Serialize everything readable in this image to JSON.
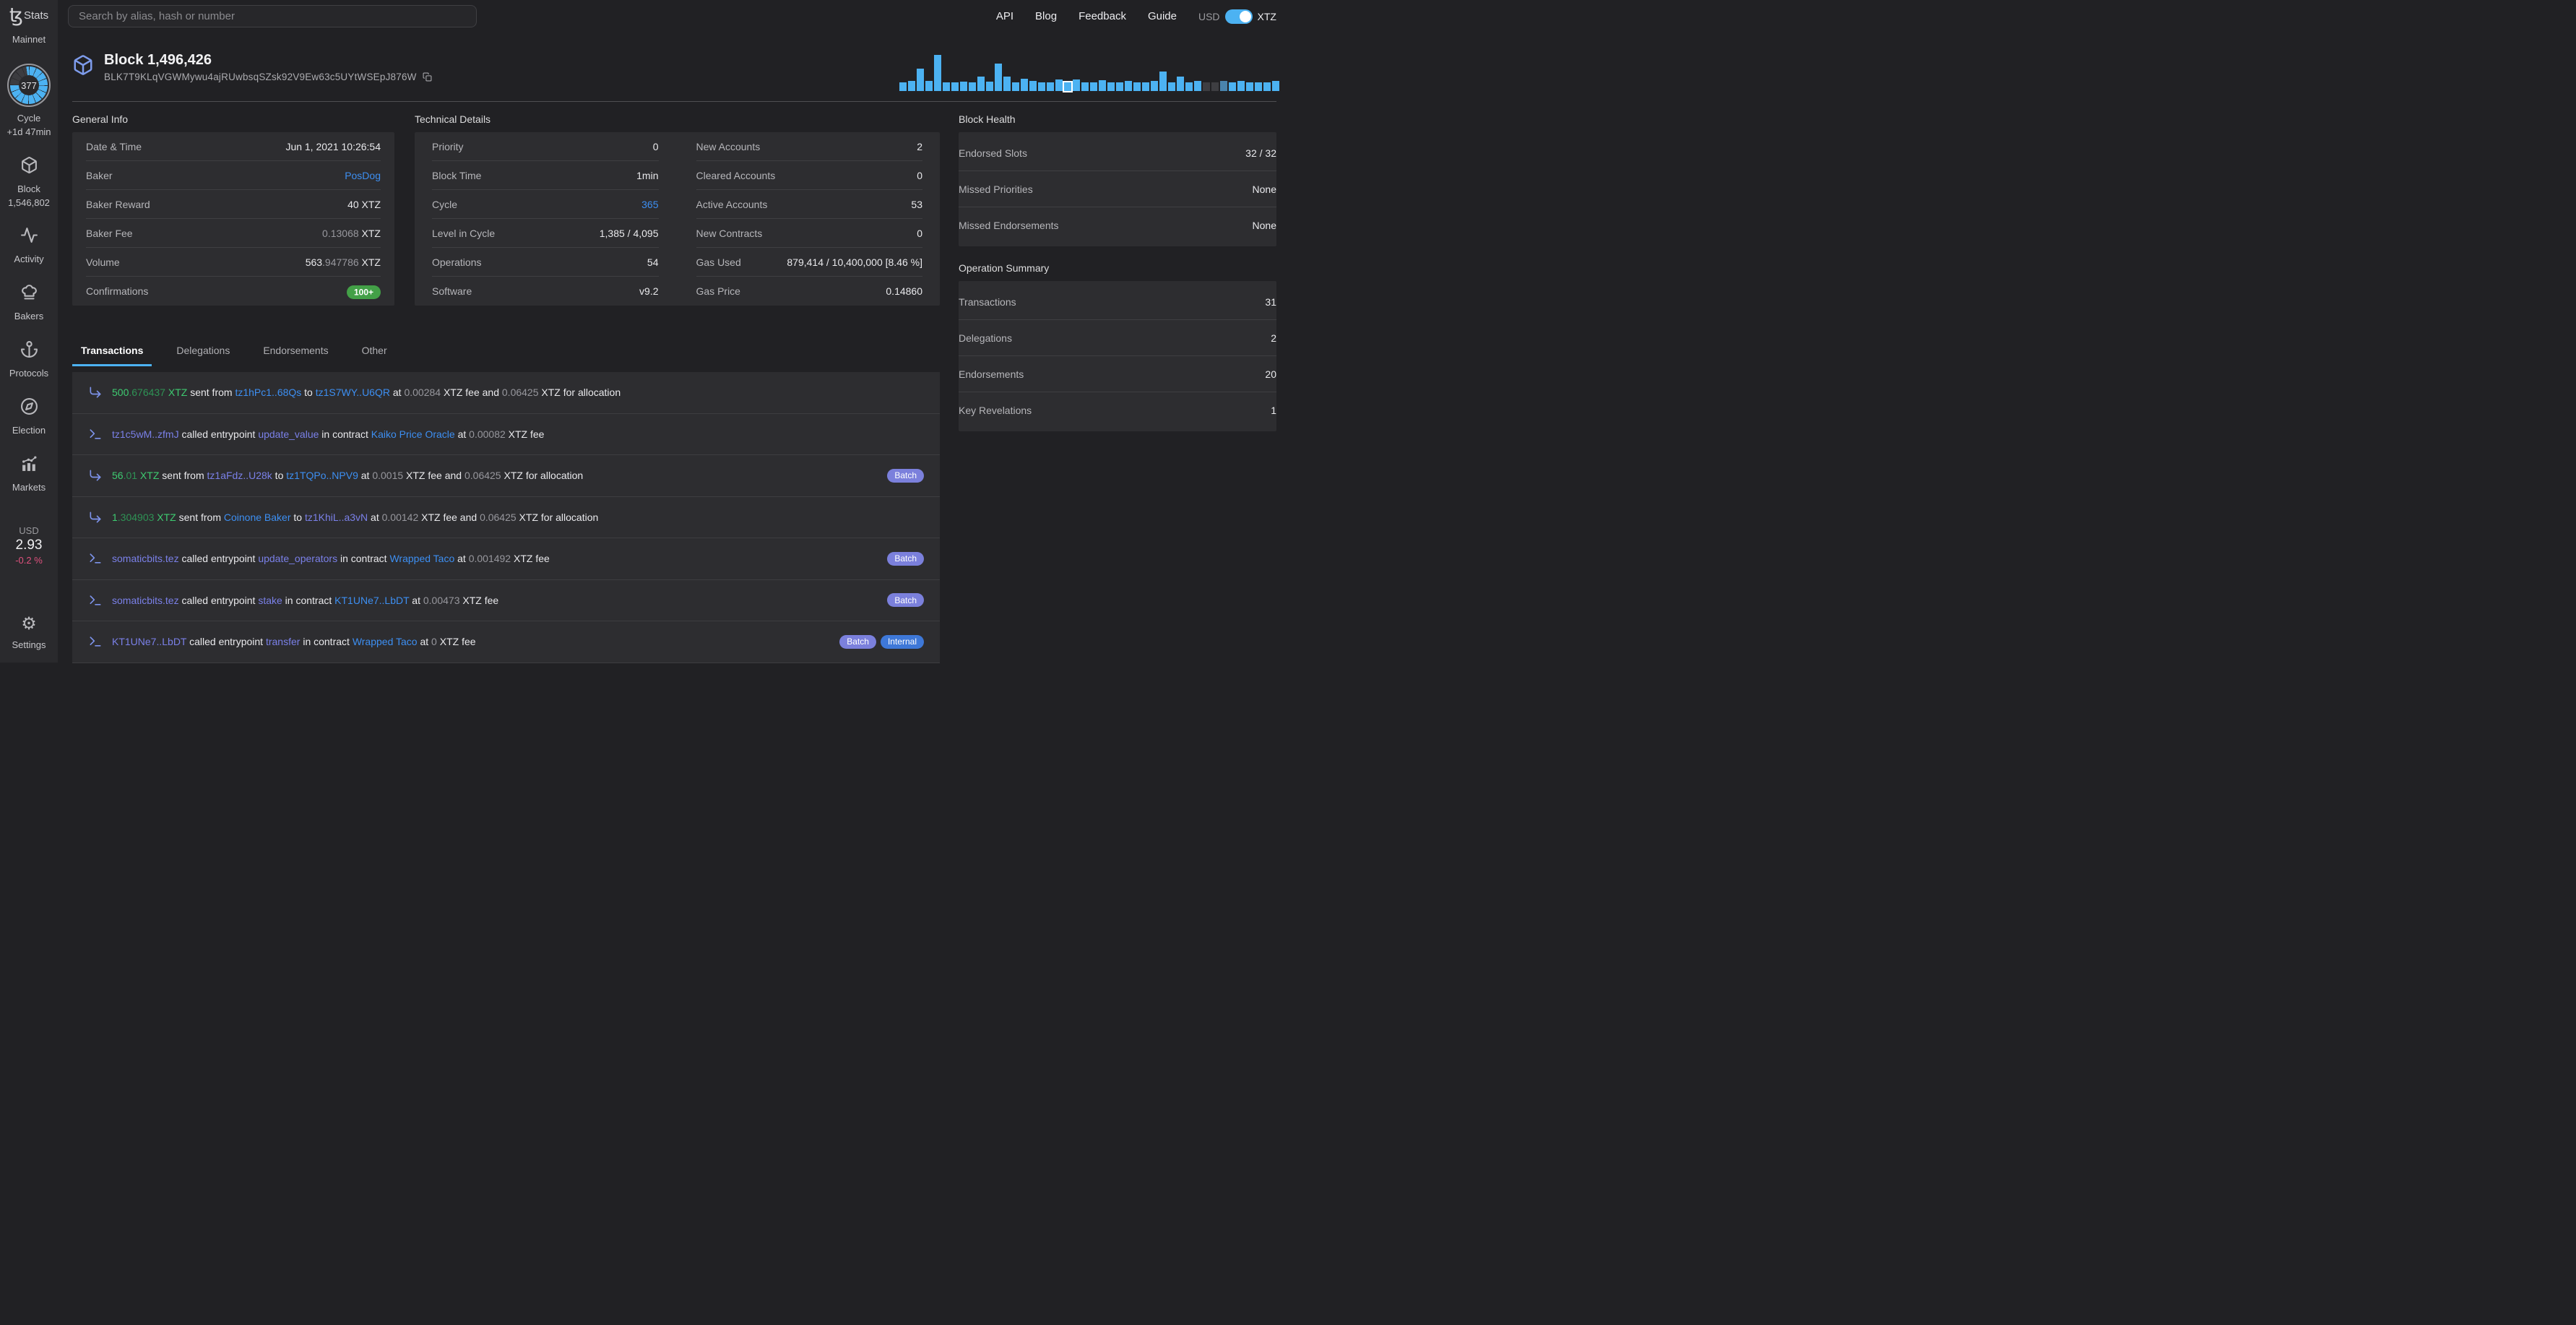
{
  "topbar": {
    "search_placeholder": "Search by alias, hash or number",
    "nav": [
      "API",
      "Blog",
      "Feedback",
      "Guide"
    ],
    "currency": {
      "left": "USD",
      "right": "XTZ",
      "accent": "#4cb2f2"
    }
  },
  "sidebar": {
    "logo_glyph": "ꜩ",
    "logo_text": "Stats",
    "network": "Mainnet",
    "cycle": {
      "number": "377",
      "label": "Cycle",
      "eta": "+1d 47min"
    },
    "items": [
      {
        "name": "block",
        "icon": "cube",
        "label": "Block",
        "sub": "1,546,802"
      },
      {
        "name": "activity",
        "icon": "activity",
        "label": "Activity",
        "sub": ""
      },
      {
        "name": "bakers",
        "icon": "chef-hat",
        "label": "Bakers",
        "sub": ""
      },
      {
        "name": "protocols",
        "icon": "anchor",
        "label": "Protocols",
        "sub": ""
      },
      {
        "name": "election",
        "icon": "compass",
        "label": "Election",
        "sub": ""
      },
      {
        "name": "markets",
        "icon": "chart",
        "label": "Markets",
        "sub": ""
      }
    ],
    "price": {
      "currency": "USD",
      "value": "2.93",
      "change": "-0.2 %"
    },
    "settings_label": "Settings"
  },
  "header": {
    "title": "Block 1,496,426",
    "hash": "BLK7T9KLqVGWMywu4ajRUwbsqSZsk92V9Ew63c5UYtWSEpJ876W"
  },
  "histogram": {
    "type": "bar",
    "bar_color": "#4cb2f2",
    "muted_color": "#3e3e42",
    "desat_color": "#4a84ad",
    "values": [
      12,
      14,
      31,
      14,
      50,
      12,
      12,
      13,
      12,
      20,
      13,
      38,
      20,
      12,
      17,
      14,
      12,
      12,
      16,
      12,
      16,
      12,
      12,
      15,
      12,
      12,
      14,
      12,
      12,
      14,
      27,
      12,
      20,
      12,
      14,
      12,
      12,
      14,
      12,
      14,
      12,
      12,
      12,
      14
    ],
    "highlight_index": 19,
    "muted_indices": [
      35,
      36
    ],
    "desat_indices": [
      37
    ]
  },
  "sections": {
    "general_info": {
      "title": "General Info",
      "rows": [
        {
          "label": "Date & Time",
          "parts": [
            {
              "t": "Jun 1, 2021 10:26:54",
              "c": "t"
            }
          ]
        },
        {
          "label": "Baker",
          "parts": [
            {
              "t": "PosDog",
              "c": "b"
            }
          ]
        },
        {
          "label": "Baker Reward",
          "parts": [
            {
              "t": "40 XTZ",
              "c": "t"
            }
          ]
        },
        {
          "label": "Baker Fee",
          "parts": [
            {
              "t": "0.13068",
              "c": "d"
            },
            {
              "t": " XTZ",
              "c": "t"
            }
          ]
        },
        {
          "label": "Volume",
          "parts": [
            {
              "t": "563",
              "c": "t"
            },
            {
              "t": ".947786",
              "c": "d"
            },
            {
              "t": " XTZ",
              "c": "t"
            }
          ]
        },
        {
          "label": "Confirmations",
          "badge": "100+"
        }
      ]
    },
    "technical": {
      "title": "Technical Details",
      "col1": [
        {
          "label": "Priority",
          "parts": [
            {
              "t": "0",
              "c": "t"
            }
          ]
        },
        {
          "label": "Block Time",
          "parts": [
            {
              "t": "1min",
              "c": "t"
            }
          ]
        },
        {
          "label": "Cycle",
          "parts": [
            {
              "t": "365",
              "c": "b"
            }
          ]
        },
        {
          "label": "Level in Cycle",
          "parts": [
            {
              "t": "1,385 / 4,095",
              "c": "t"
            }
          ]
        },
        {
          "label": "Operations",
          "parts": [
            {
              "t": "54",
              "c": "t"
            }
          ]
        },
        {
          "label": "Software",
          "parts": [
            {
              "t": "v9.2",
              "c": "t"
            }
          ]
        }
      ],
      "col2": [
        {
          "label": "New Accounts",
          "parts": [
            {
              "t": "2",
              "c": "t"
            }
          ]
        },
        {
          "label": "Cleared Accounts",
          "parts": [
            {
              "t": "0",
              "c": "t"
            }
          ]
        },
        {
          "label": "Active Accounts",
          "parts": [
            {
              "t": "53",
              "c": "t"
            }
          ]
        },
        {
          "label": "New Contracts",
          "parts": [
            {
              "t": "0",
              "c": "t"
            }
          ]
        },
        {
          "label": "Gas Used",
          "parts": [
            {
              "t": "879,414 / 10,400,000 [8.46 %]",
              "c": "t"
            }
          ]
        },
        {
          "label": "Gas Price",
          "parts": [
            {
              "t": "0.14860",
              "c": "t"
            }
          ]
        }
      ]
    },
    "block_health": {
      "title": "Block Health",
      "rows": [
        {
          "label": "Endorsed Slots",
          "parts": [
            {
              "t": "32 / 32",
              "c": "t"
            }
          ]
        },
        {
          "label": "Missed Priorities",
          "parts": [
            {
              "t": "None",
              "c": "t"
            }
          ]
        },
        {
          "label": "Missed Endorsements",
          "parts": [
            {
              "t": "None",
              "c": "t"
            }
          ]
        }
      ]
    },
    "operation_summary": {
      "title": "Operation Summary",
      "rows": [
        {
          "label": "Transactions",
          "parts": [
            {
              "t": "31",
              "c": "t"
            }
          ]
        },
        {
          "label": "Delegations",
          "parts": [
            {
              "t": "2",
              "c": "t"
            }
          ]
        },
        {
          "label": "Endorsements",
          "parts": [
            {
              "t": "20",
              "c": "t"
            }
          ]
        },
        {
          "label": "Key Revelations",
          "parts": [
            {
              "t": "1",
              "c": "t"
            }
          ]
        }
      ]
    }
  },
  "tabs": [
    {
      "label": "Transactions",
      "active": true
    },
    {
      "label": "Delegations",
      "active": false
    },
    {
      "label": "Endorsements",
      "active": false
    },
    {
      "label": "Other",
      "active": false
    }
  ],
  "operations": {
    "rows": [
      {
        "icon": "corner-down-right",
        "badges": [],
        "segs": [
          {
            "t": "500",
            "c": "g"
          },
          {
            "t": ".676437",
            "c": "gd"
          },
          {
            "t": " XTZ",
            "c": "g"
          },
          {
            "t": " sent from ",
            "c": "t"
          },
          {
            "t": "tz1hPc1..68Qs",
            "c": "b"
          },
          {
            "t": " to ",
            "c": "t"
          },
          {
            "t": "tz1S7WY..U6QR",
            "c": "b"
          },
          {
            "t": " at ",
            "c": "t"
          },
          {
            "t": "0.00284",
            "c": "n"
          },
          {
            "t": " XTZ fee and ",
            "c": "t"
          },
          {
            "t": "0.06425",
            "c": "n"
          },
          {
            "t": " XTZ for allocation",
            "c": "t"
          }
        ]
      },
      {
        "icon": "terminal",
        "badges": [],
        "segs": [
          {
            "t": "tz1c5wM..zfmJ",
            "c": "p"
          },
          {
            "t": " called entrypoint ",
            "c": "t"
          },
          {
            "t": "update_value",
            "c": "p"
          },
          {
            "t": " in contract ",
            "c": "t"
          },
          {
            "t": "Kaiko Price Oracle",
            "c": "b"
          },
          {
            "t": " at ",
            "c": "t"
          },
          {
            "t": "0.00082",
            "c": "n"
          },
          {
            "t": " XTZ fee",
            "c": "t"
          }
        ]
      },
      {
        "icon": "corner-down-right",
        "badges": [
          "Batch"
        ],
        "segs": [
          {
            "t": "56",
            "c": "g"
          },
          {
            "t": ".01",
            "c": "gd"
          },
          {
            "t": " XTZ",
            "c": "g"
          },
          {
            "t": " sent from ",
            "c": "t"
          },
          {
            "t": "tz1aFdz..U28k",
            "c": "p"
          },
          {
            "t": " to ",
            "c": "t"
          },
          {
            "t": "tz1TQPo..NPV9",
            "c": "b"
          },
          {
            "t": " at ",
            "c": "t"
          },
          {
            "t": "0.0015",
            "c": "n"
          },
          {
            "t": " XTZ fee and ",
            "c": "t"
          },
          {
            "t": "0.06425",
            "c": "n"
          },
          {
            "t": " XTZ for allocation",
            "c": "t"
          }
        ]
      },
      {
        "icon": "corner-down-right",
        "badges": [],
        "segs": [
          {
            "t": "1",
            "c": "g"
          },
          {
            "t": ".304903",
            "c": "gd"
          },
          {
            "t": " XTZ",
            "c": "g"
          },
          {
            "t": " sent from ",
            "c": "t"
          },
          {
            "t": "Coinone Baker",
            "c": "b"
          },
          {
            "t": " to ",
            "c": "t"
          },
          {
            "t": "tz1KhiL..a3vN",
            "c": "p"
          },
          {
            "t": " at ",
            "c": "t"
          },
          {
            "t": "0.00142",
            "c": "n"
          },
          {
            "t": " XTZ fee and ",
            "c": "t"
          },
          {
            "t": "0.06425",
            "c": "n"
          },
          {
            "t": " XTZ for allocation",
            "c": "t"
          }
        ]
      },
      {
        "icon": "terminal",
        "badges": [
          "Batch"
        ],
        "segs": [
          {
            "t": "somaticbits.tez",
            "c": "p"
          },
          {
            "t": " called entrypoint ",
            "c": "t"
          },
          {
            "t": "update_operators",
            "c": "p"
          },
          {
            "t": " in contract ",
            "c": "t"
          },
          {
            "t": "Wrapped Taco",
            "c": "b"
          },
          {
            "t": " at ",
            "c": "t"
          },
          {
            "t": "0.001492",
            "c": "n"
          },
          {
            "t": " XTZ fee",
            "c": "t"
          }
        ]
      },
      {
        "icon": "terminal",
        "badges": [
          "Batch"
        ],
        "segs": [
          {
            "t": "somaticbits.tez",
            "c": "p"
          },
          {
            "t": " called entrypoint ",
            "c": "t"
          },
          {
            "t": "stake",
            "c": "p"
          },
          {
            "t": " in contract ",
            "c": "t"
          },
          {
            "t": "KT1UNe7..LbDT",
            "c": "b"
          },
          {
            "t": " at ",
            "c": "t"
          },
          {
            "t": "0.00473",
            "c": "n"
          },
          {
            "t": " XTZ fee",
            "c": "t"
          }
        ]
      },
      {
        "icon": "terminal",
        "badges": [
          "Batch",
          "Internal"
        ],
        "segs": [
          {
            "t": "KT1UNe7..LbDT",
            "c": "p"
          },
          {
            "t": " called entrypoint ",
            "c": "t"
          },
          {
            "t": "transfer",
            "c": "p"
          },
          {
            "t": " in contract ",
            "c": "t"
          },
          {
            "t": "Wrapped Taco",
            "c": "b"
          },
          {
            "t": " at ",
            "c": "t"
          },
          {
            "t": "0",
            "c": "n"
          },
          {
            "t": " XTZ fee",
            "c": "t"
          }
        ]
      }
    ]
  }
}
